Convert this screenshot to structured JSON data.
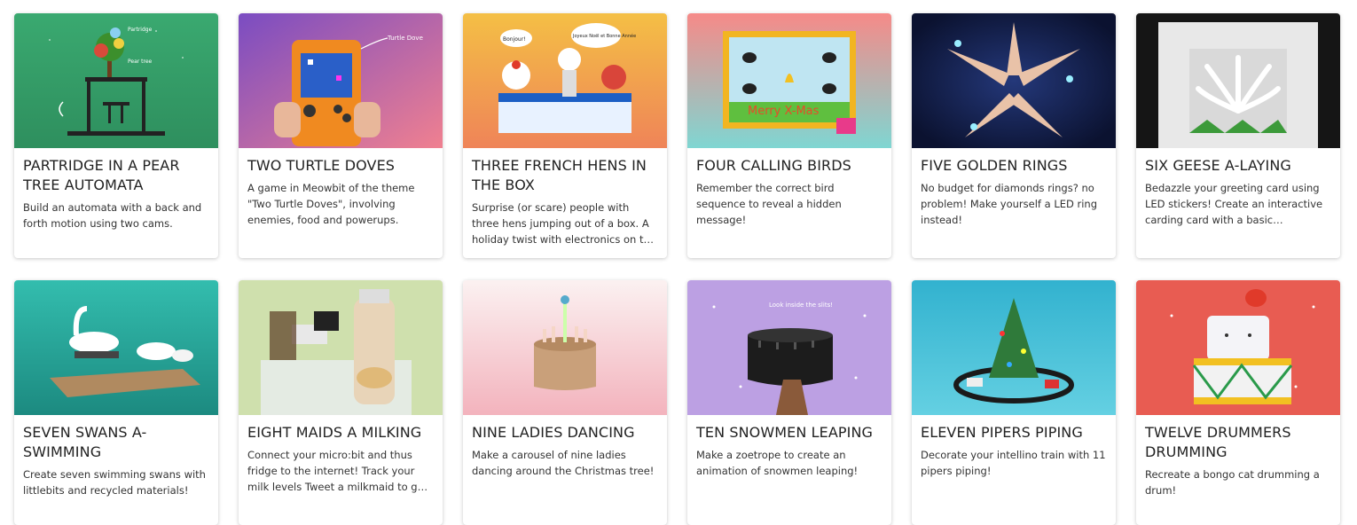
{
  "cards": [
    {
      "title": "PARTRIDGE IN A PEAR TREE AUTOMATA",
      "desc": "Build an automata with a back and forth motion using two cams.",
      "thumb_labels": [
        "Partridge",
        "Pear tree"
      ],
      "bg": [
        "#2f9e6a",
        "#4cc48a"
      ]
    },
    {
      "title": "TWO TURTLE DOVES",
      "desc": "A game in Meowbit of the theme \"Two Turtle Doves\", involving enemies, food and powerups.",
      "thumb_labels": [
        "Turtle Dove"
      ],
      "bg": [
        "#7b4fc0",
        "#e06a8a"
      ]
    },
    {
      "title": "THREE FRENCH HENS IN THE BOX",
      "desc": "Surprise (or scare) people with three hens jumping out of a box. A holiday twist with electronics on the classic…",
      "thumb_labels": [
        "Bonjour!",
        "Joyeux Noël et Bonne Année"
      ],
      "bg": [
        "#f2b340",
        "#f28a55"
      ]
    },
    {
      "title": "FOUR CALLING BIRDS",
      "desc": "Remember the correct bird sequence to reveal a hidden message!",
      "thumb_labels": [
        "Merry X-Mas"
      ],
      "bg": [
        "#f3928e",
        "#7fd3cf"
      ]
    },
    {
      "title": "FIVE GOLDEN RINGS",
      "desc": "No budget for diamonds rings? no problem! Make yourself a LED ring instead!",
      "thumb_labels": [],
      "bg": [
        "#0e1535",
        "#1d2d66"
      ]
    },
    {
      "title": "SIX GEESE A-LAYING",
      "desc": "Bedazzle your greeting card using LED stickers! Create an interactive carding card with a basic…",
      "thumb_labels": [],
      "bg": [
        "#111111",
        "#2a2a2a"
      ]
    },
    {
      "title": "SEVEN SWANS A-SWIMMING",
      "desc": "Create seven swimming swans with littlebits and recycled materials!",
      "thumb_labels": [],
      "bg": [
        "#2fb6a8",
        "#1e8f86"
      ]
    },
    {
      "title": "EIGHT MAIDS A MILKING",
      "desc": "Connect your micro:bit and thus fridge to the internet! Track your milk levels Tweet a milkmaid to get more…",
      "thumb_labels": [],
      "bg": [
        "#c7dca6",
        "#dbe8bd"
      ]
    },
    {
      "title": "NINE LADIES DANCING",
      "desc": "Make a carousel of nine ladies dancing around the Christmas tree!",
      "thumb_labels": [],
      "bg": [
        "#fbeeee",
        "#f4b8c0"
      ]
    },
    {
      "title": "TEN SNOWMEN LEAPING",
      "desc": "Make a zoetrope to create an animation of snowmen leaping!",
      "thumb_labels": [
        "Look inside the slits!"
      ],
      "bg": [
        "#b99be0",
        "#c9adea"
      ]
    },
    {
      "title": "ELEVEN PIPERS PIPING",
      "desc": "Decorate your intellino train with 11 pipers piping!",
      "thumb_labels": [],
      "bg": [
        "#37b7d2",
        "#5fcde0"
      ]
    },
    {
      "title": "TWELVE DRUMMERS DRUMMING",
      "desc": "Recreate a bongo cat drumming a drum!",
      "thumb_labels": [],
      "bg": [
        "#e0564f",
        "#ef7468"
      ]
    }
  ]
}
